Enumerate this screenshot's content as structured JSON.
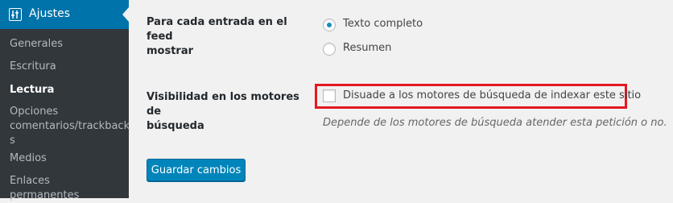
{
  "sidebar": {
    "menu_title": "Ajustes",
    "items": [
      {
        "label": "Generales"
      },
      {
        "label": "Escritura"
      },
      {
        "label": "Lectura"
      },
      {
        "label": "Opciones\ncomentarios/trackback\ns"
      },
      {
        "label": "Medios"
      },
      {
        "label": "Enlaces permanentes"
      }
    ]
  },
  "feed": {
    "label_line1": "Para cada entrada en el feed",
    "label_line2": "mostrar",
    "options": [
      {
        "label": "Texto completo",
        "checked": true
      },
      {
        "label": "Resumen",
        "checked": false
      }
    ]
  },
  "visibility": {
    "label_line1": "Visibilidad en los motores de",
    "label_line2": "búsqueda",
    "checkbox_label": "Disuade a los motores de búsqueda de indexar este sitio",
    "checked": false,
    "description": "Depende de los motores de búsqueda atender esta petición o no."
  },
  "save_label": "Guardar cambios",
  "colors": {
    "sidebar_bg": "#23282d",
    "submenu_bg": "#32373c",
    "active_menu": "#0073aa",
    "primary_button": "#0085ba",
    "highlight_border": "#e3191f"
  }
}
